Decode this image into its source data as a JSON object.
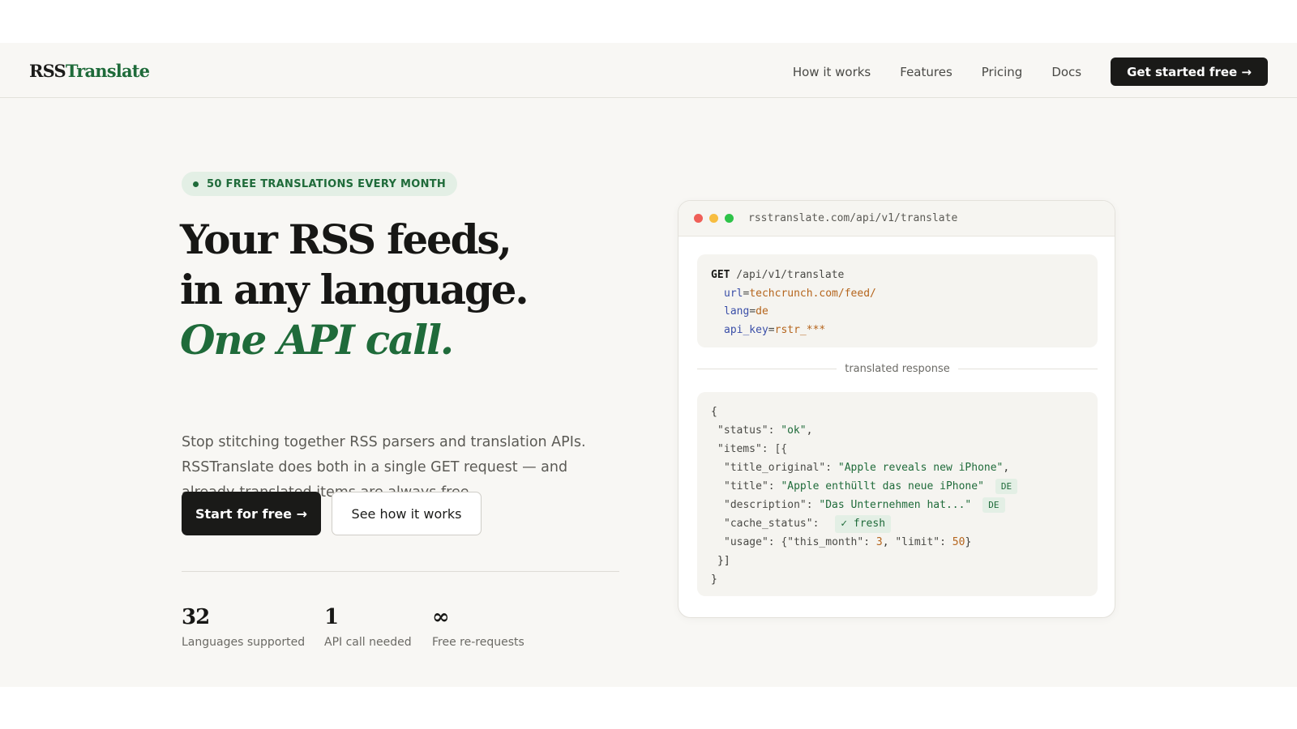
{
  "header": {
    "logo_primary": "RSS",
    "logo_accent": "Translate",
    "nav": [
      "How it works",
      "Features",
      "Pricing",
      "Docs"
    ],
    "cta": "Get started free →"
  },
  "hero": {
    "badge": "50 FREE TRANSLATIONS EVERY MONTH",
    "headline": [
      "Your RSS feeds,",
      "in any language.",
      "One API call."
    ],
    "lede": "Stop stitching together RSS parsers and translation APIs. RSSTranslate does both in a single GET request — and already-translated items are always free.",
    "primary_button": "Start for free →",
    "secondary_button": "See how it works",
    "stats": [
      {
        "value": "32",
        "label": "Languages supported"
      },
      {
        "value": "1",
        "label": "API call needed"
      },
      {
        "value": "∞",
        "label": "Free re-requests"
      }
    ]
  },
  "code_window": {
    "url": "rsstranslate.com/api/v1/translate",
    "request": {
      "method": "GET",
      "path": " /api/v1/translate",
      "params": [
        {
          "key": "url",
          "value": "techcrunch.com/feed/"
        },
        {
          "key": "lang",
          "value": "de"
        },
        {
          "key": "api_key",
          "value": "rstr_***"
        }
      ]
    },
    "separator": "translated response",
    "response": {
      "open_brace": "{",
      "status_key": "\"status\": ",
      "status_val": "\"ok\"",
      "items_key": "\"items\": [{",
      "title_original_key": "\"title_original\": ",
      "title_original_val": "\"Apple reveals new iPhone\"",
      "title_key": "\"title\": ",
      "title_val": "\"Apple enthüllt das neue iPhone\"",
      "description_key": "\"description\": ",
      "description_val": "\"Das Unternehmen hat...\"",
      "lang_tag": "DE",
      "cache_key": "\"cache_status\": ",
      "cache_val": "✓ fresh",
      "usage_key": "\"usage\": {",
      "this_month_key": "\"this_month\": ",
      "this_month_val": "3",
      "limit_key": "\"limit\": ",
      "limit_val": "50",
      "close_items": "}]",
      "close_brace": "}"
    }
  },
  "colors": {
    "accent_green": "#1f6b3a",
    "dark": "#1a1a18",
    "page_bg": "#f8f7f4",
    "badge_bg": "#e3efe5"
  }
}
